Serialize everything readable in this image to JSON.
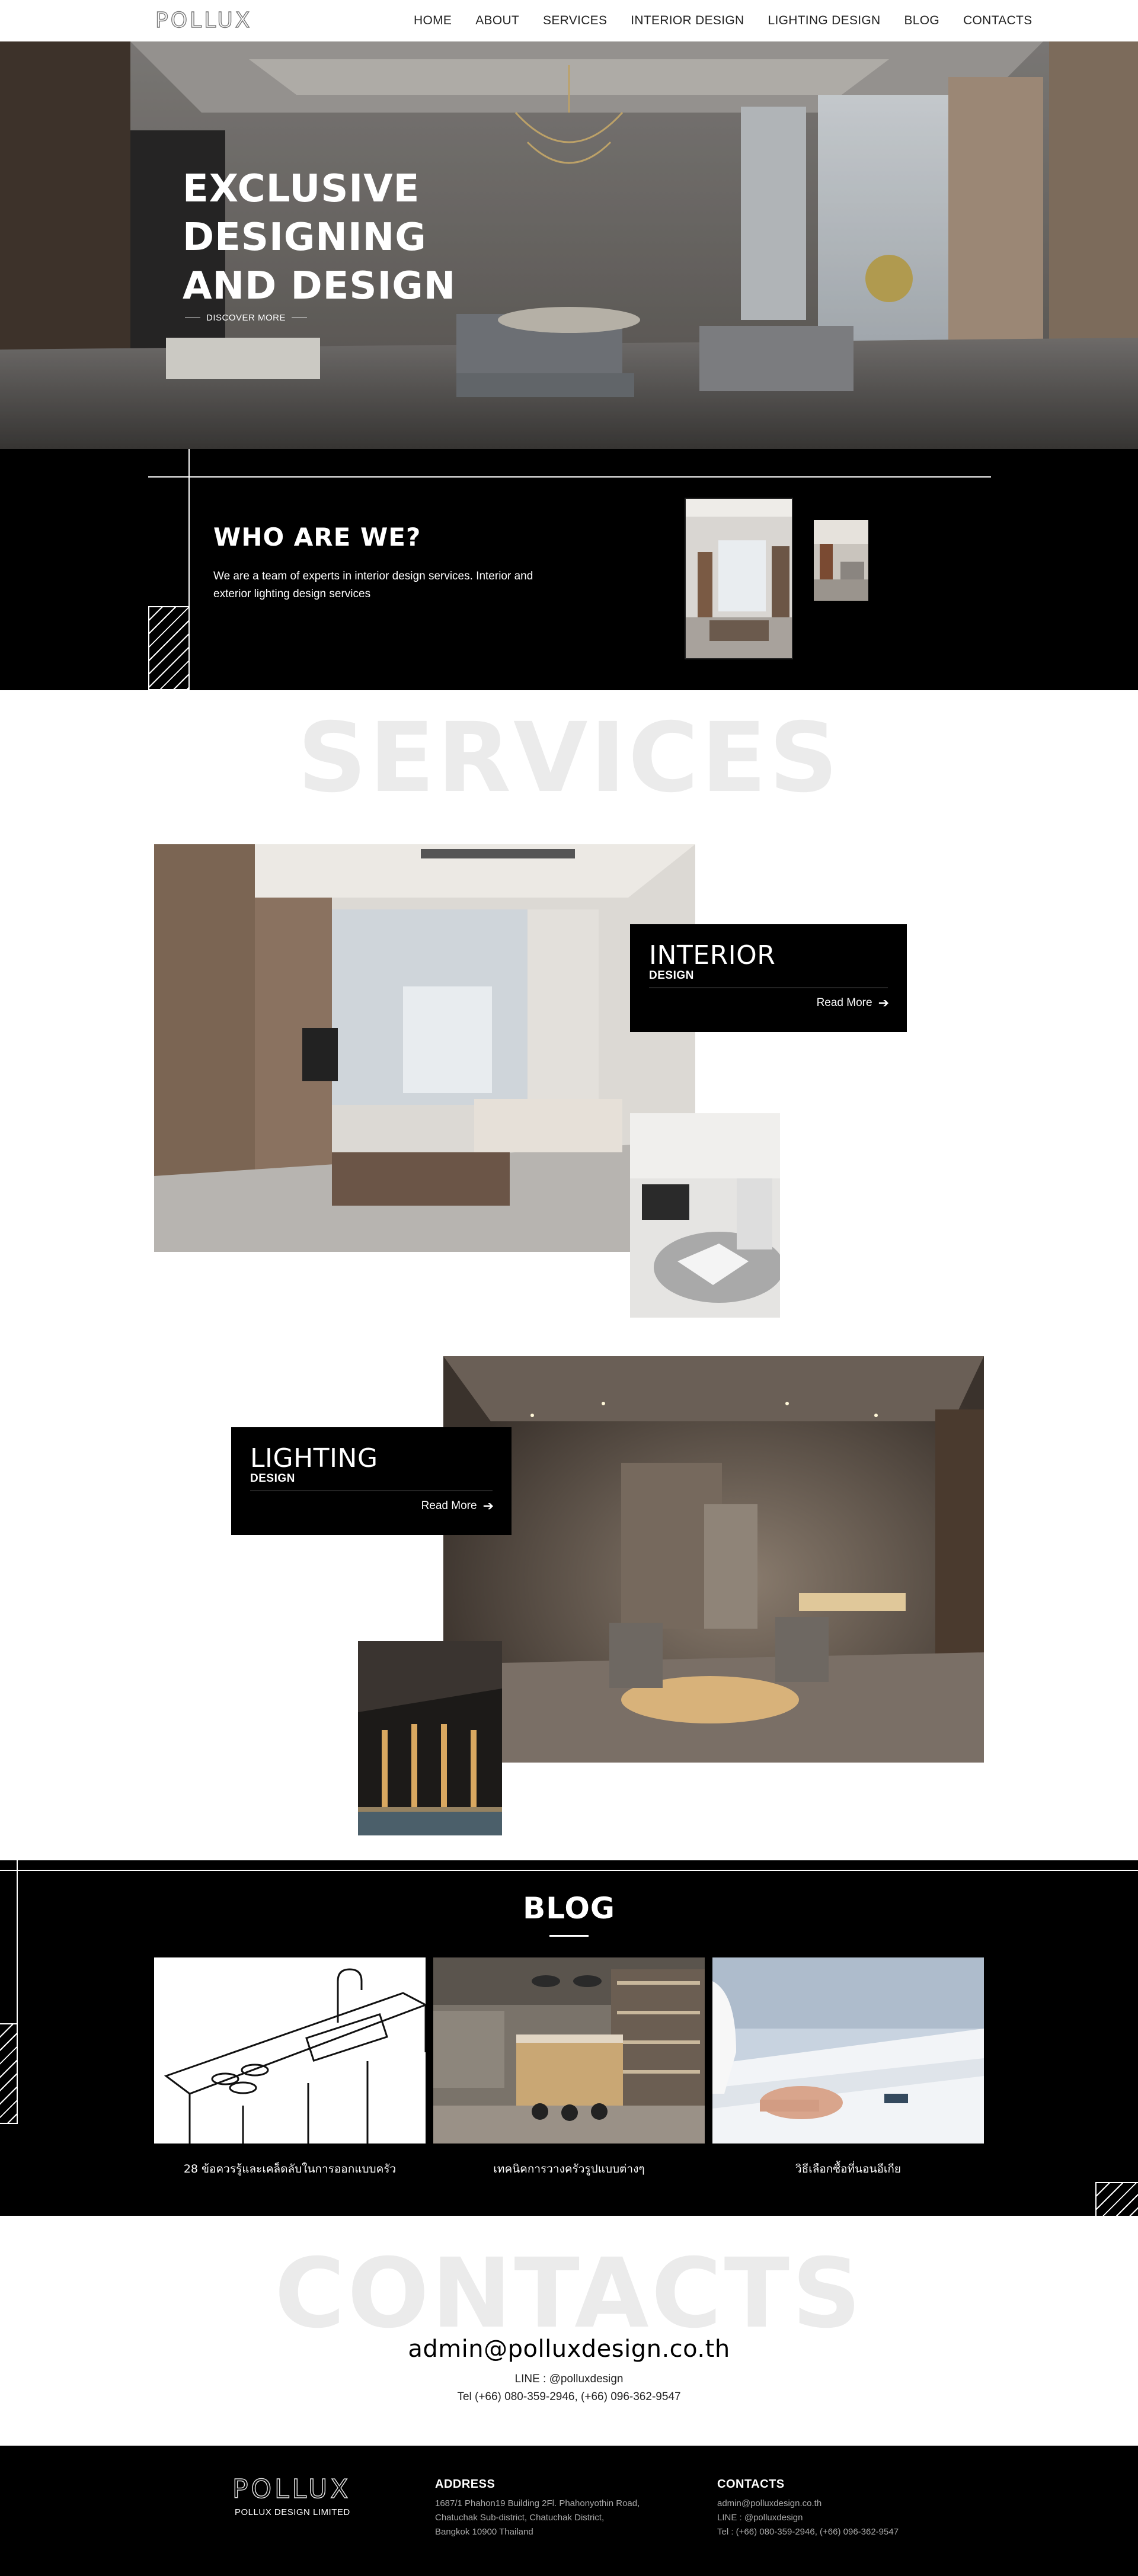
{
  "nav": {
    "logo": "POLLUX",
    "items": [
      {
        "label": "HOME"
      },
      {
        "label": "ABOUT"
      },
      {
        "label": "SERVICES"
      },
      {
        "label": "INTERIOR DESIGN"
      },
      {
        "label": "LIGHTING DESIGN"
      },
      {
        "label": "BLOG"
      },
      {
        "label": "CONTACTS"
      }
    ]
  },
  "hero": {
    "title_lines": [
      "EXCLUSIVE",
      "DESIGNING",
      "AND DESIGN"
    ],
    "cta": "DISCOVER MORE"
  },
  "who": {
    "title": "WHO ARE WE?",
    "text": "We are a team of experts in interior design services. Interior and exterior lighting design services"
  },
  "services": {
    "heading": "SERVICES",
    "interior": {
      "title": "INTERIOR",
      "subtitle": "DESIGN",
      "more": "Read More"
    },
    "lighting": {
      "title": "LIGHTING",
      "subtitle": "DESIGN",
      "more": "Read More"
    }
  },
  "blog": {
    "title": "BLOG",
    "posts": [
      {
        "caption": "28 ข้อควรรู้และเคล็ดลับในการออกแบบครัว"
      },
      {
        "caption": "เทคนิคการวางครัวรูปแบบต่างๆ"
      },
      {
        "caption": "วิธีเลือกซื้อที่นอนอีเกีย"
      }
    ]
  },
  "contacts": {
    "heading": "CONTACTS",
    "email": "admin@polluxdesign.co.th",
    "line": "LINE : @polluxdesign",
    "tel": "Tel (+66) 080-359-2946, (+66) 096-362-9547"
  },
  "footer": {
    "logo": "POLLUX",
    "company": "POLLUX DESIGN LIMITED",
    "address_head": "ADDRESS",
    "address_lines": [
      "1687/1 Phahon19 Building 2Fl. Phahonyothin Road,",
      "Chatuchak Sub-district, Chatuchak District,",
      "Bangkok 10900 Thailand"
    ],
    "contacts_head": "CONTACTS",
    "contact_lines": [
      "admin@polluxdesign.co.th",
      "LINE : @polluxdesign",
      "Tel : (+66) 080-359-2946, (+66) 096-362-9547"
    ]
  },
  "icons": {
    "read_more_arrow": "arrow-right-icon"
  },
  "colors": {
    "dark": "#000000",
    "light": "#ffffff",
    "watermark": "#ebebeb"
  }
}
